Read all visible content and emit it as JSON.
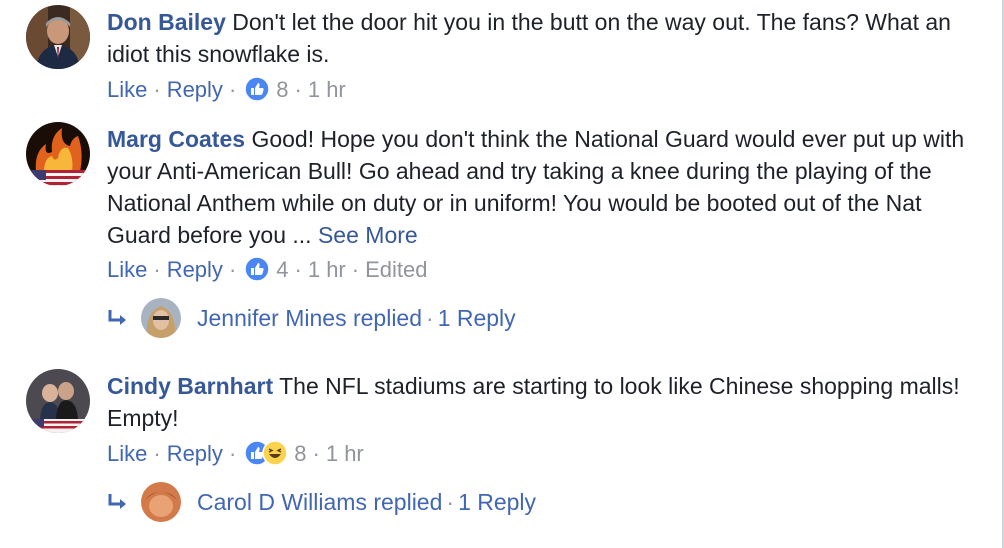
{
  "comments": [
    {
      "author": "Don Bailey",
      "text": "Don't let the door hit you in the butt on the way out. The fans? What an idiot this snowflake is.",
      "like": "Like",
      "reply": "Reply",
      "reaction_count": "8",
      "time": "1 hr",
      "reactions": [
        "like-icon"
      ]
    },
    {
      "author": "Marg Coates",
      "text": "Good! Hope you don't think the National Guard would ever put up with your Anti-American Bull! Go ahead and try taking a knee during the playing of the National Anthem while on duty or in uniform! You would be booted out of the Nat Guard before you ...",
      "see_more": "See More",
      "like": "Like",
      "reply": "Reply",
      "reaction_count": "4",
      "time": "1 hr",
      "edited": "Edited",
      "reactions": [
        "like-icon"
      ],
      "replies": {
        "name": "Jennifer Mines",
        "replied": "replied",
        "count": "1 Reply"
      }
    },
    {
      "author": "Cindy Barnhart",
      "text": "The NFL stadiums are starting to look like Chinese shopping malls! Empty!",
      "like": "Like",
      "reply": "Reply",
      "reaction_count": "8",
      "time": "1 hr",
      "reactions": [
        "like-icon",
        "haha-icon"
      ],
      "replies": {
        "name": "Carol D Williams",
        "replied": "replied",
        "count": "1 Reply"
      }
    }
  ],
  "separator": "·",
  "colors": {
    "link": "#365899",
    "action": "#4267b2",
    "meta": "#90949c",
    "like": "#4a86f4"
  }
}
